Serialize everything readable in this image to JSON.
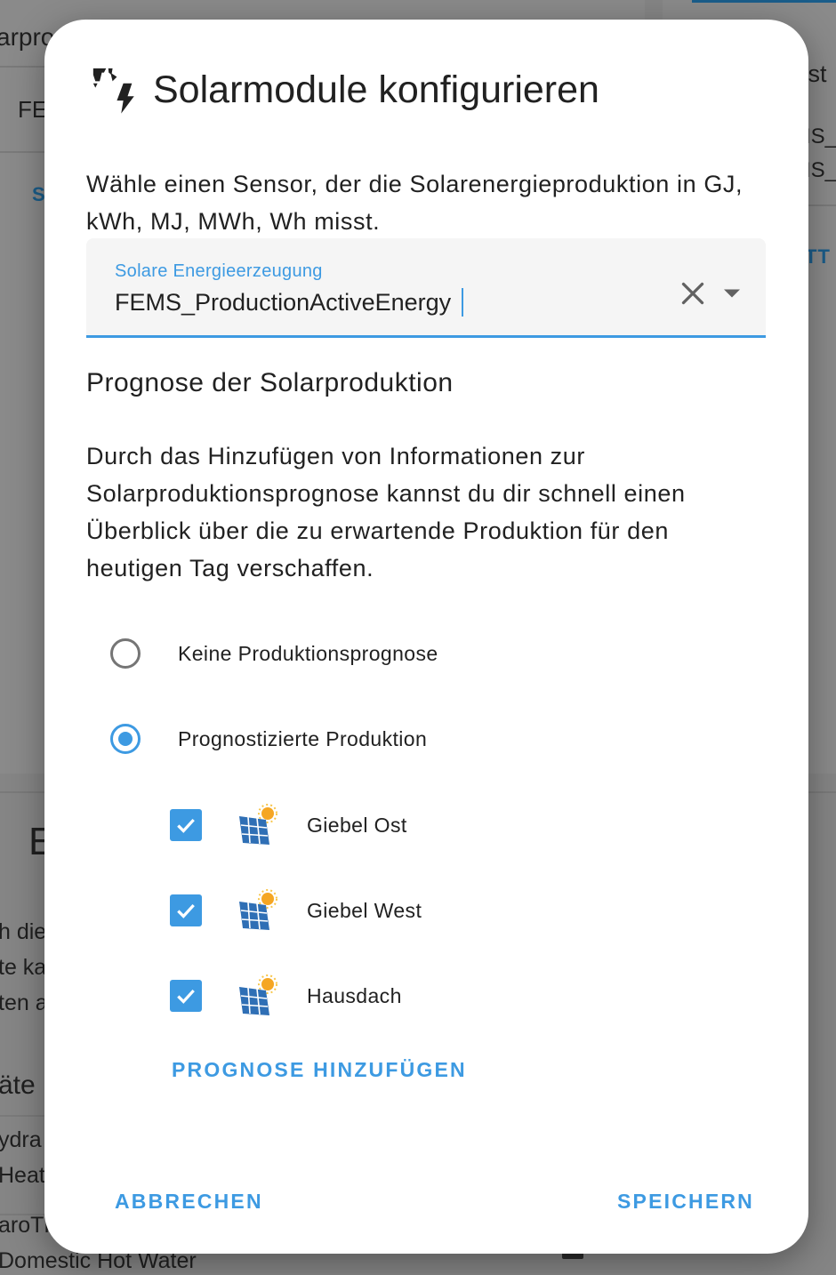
{
  "background": {
    "texts": [
      "arprod",
      "FE",
      "S",
      "yst",
      "IS_",
      "IS_",
      "TT",
      "E",
      "h die",
      "te ka",
      "ten a",
      "äte",
      "ydra",
      "Heat",
      "aroTH",
      "Domestic Hot Water"
    ]
  },
  "dialog": {
    "title": "Solarmodule konfigurieren",
    "title_icon": "solar-power-icon",
    "description": "Wähle einen Sensor, der die Solarenergieproduktion in GJ, kWh, MJ, MWh, Wh misst.",
    "sensor_field": {
      "label": "Solare Energieerzeugung",
      "value": "FEMS_ProductionActiveEnergy",
      "clear_icon": "close-icon",
      "dropdown_icon": "arrow-drop-down-icon"
    },
    "forecast": {
      "title": "Prognose der Solarproduktion",
      "description": "Durch das Hinzufügen von Informationen zur Solarproduktionsprognose kannst du dir schnell einen Überblick über die zu erwartende Produktion für den heutigen Tag verschaffen.",
      "options": [
        {
          "label": "Keine Produktionsprognose",
          "selected": false
        },
        {
          "label": "Prognostizierte Produktion",
          "selected": true
        }
      ],
      "sources": [
        {
          "label": "Giebel Ost",
          "checked": true,
          "icon": "forecast-solar-icon"
        },
        {
          "label": "Giebel West",
          "checked": true,
          "icon": "forecast-solar-icon"
        },
        {
          "label": "Hausdach",
          "checked": true,
          "icon": "forecast-solar-icon"
        }
      ],
      "add_button": "PROGNOSE HINZUFÜGEN"
    },
    "cancel_button": "ABBRECHEN",
    "save_button": "SPEICHERN"
  },
  "colors": {
    "accent": "#3d9ae2",
    "text": "#212121",
    "radio_off": "#757575",
    "field_bg": "#f5f5f5",
    "scrim": "#858585"
  }
}
